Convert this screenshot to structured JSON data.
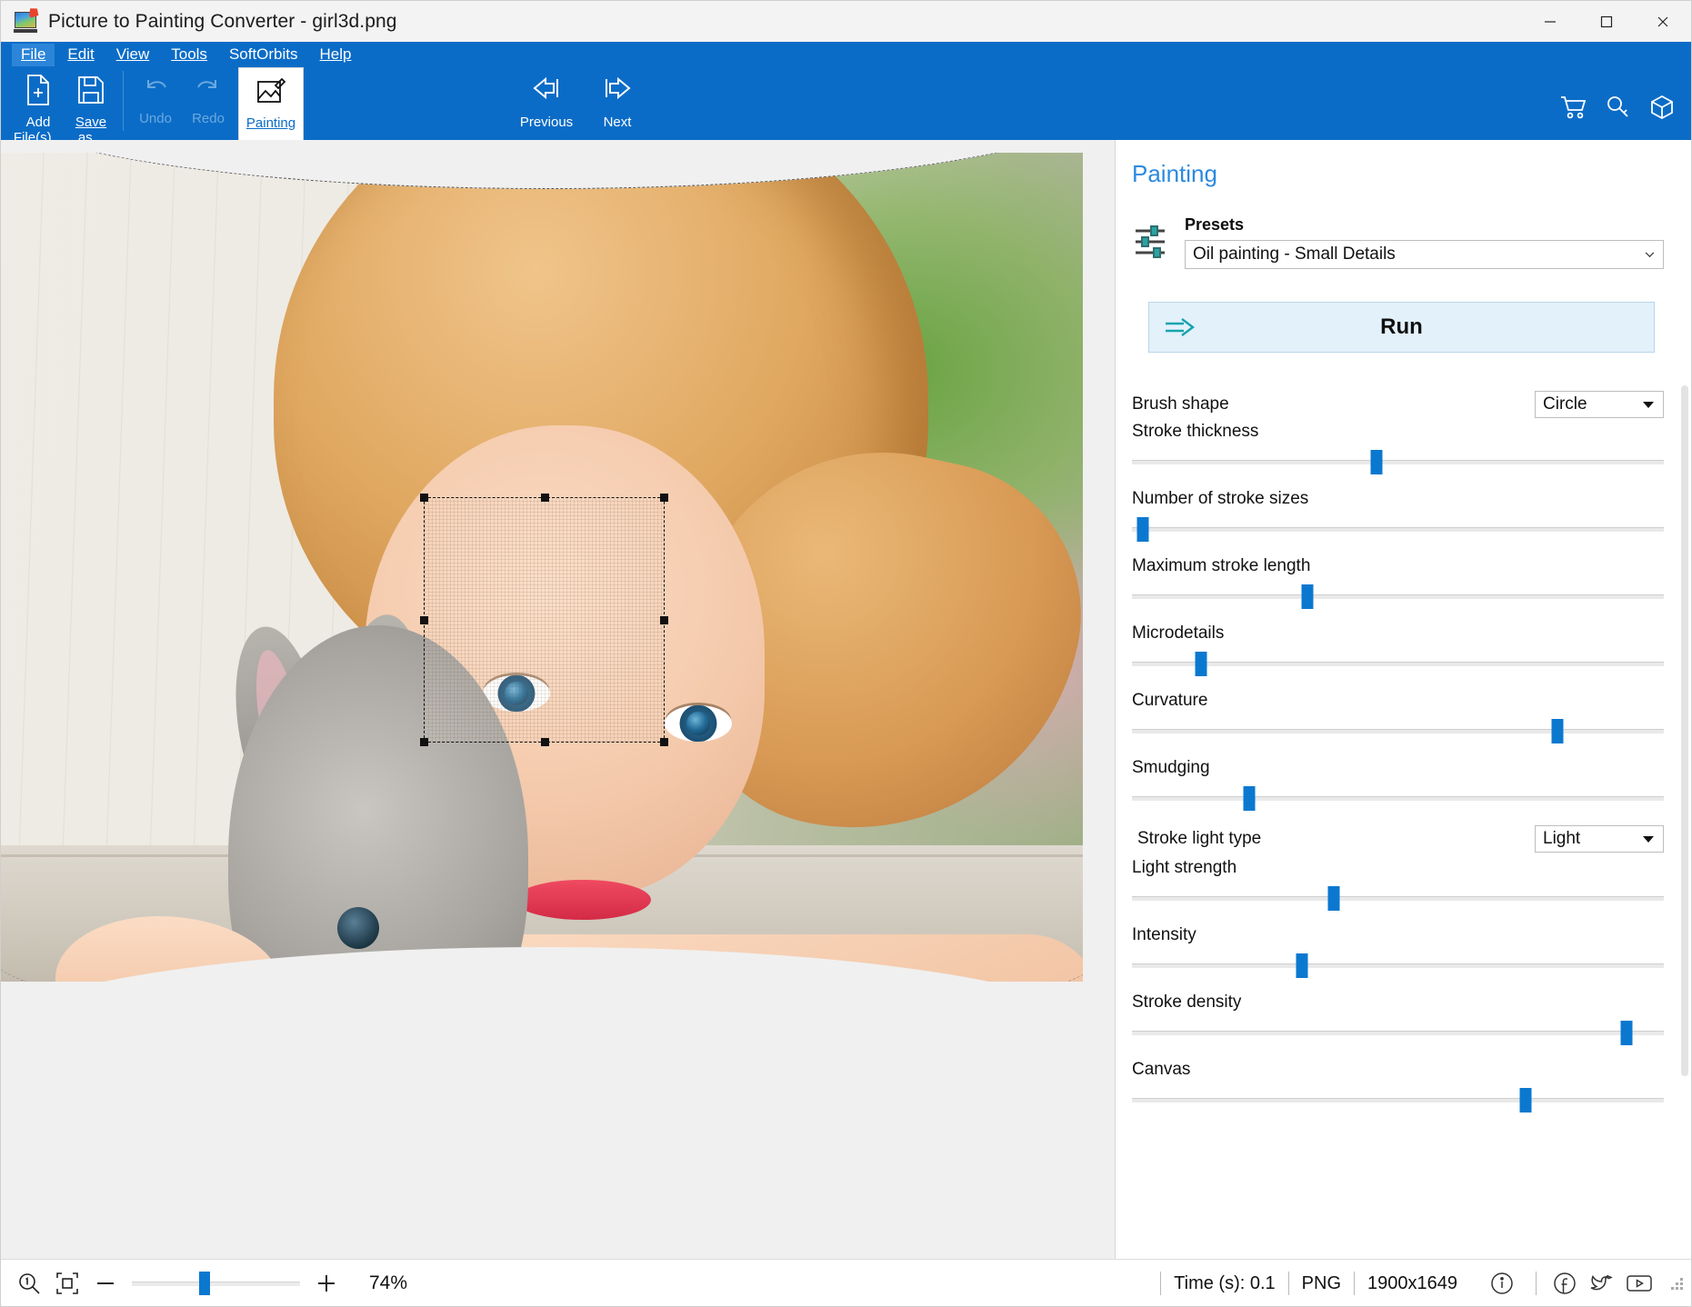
{
  "window": {
    "title": "Picture to Painting Converter - girl3d.png",
    "app_icon": "picture-to-painting-icon",
    "minimize_label": "Minimize",
    "maximize_label": "Maximize",
    "close_label": "Close"
  },
  "menubar": {
    "items": [
      {
        "label": "File",
        "accel": "F",
        "active": true
      },
      {
        "label": "Edit",
        "accel": "E",
        "active": false
      },
      {
        "label": "View",
        "accel": "V",
        "active": false
      },
      {
        "label": "Tools",
        "accel": "T",
        "active": false
      },
      {
        "label": "SoftOrbits",
        "accel": "",
        "active": false
      },
      {
        "label": "Help",
        "accel": "H",
        "active": false
      }
    ]
  },
  "ribbon": {
    "add_files_line1": "Add",
    "add_files_line2": "File(s)...",
    "save_as_line1": "Save",
    "save_as_line2": "as...",
    "undo_label": "Undo",
    "redo_label": "Redo",
    "painting_label": "Painting",
    "previous_label": "Previous",
    "next_label": "Next",
    "right_icons": [
      "cart-icon",
      "key-icon",
      "box-icon"
    ]
  },
  "panel": {
    "title": "Painting",
    "presets_label": "Presets",
    "presets_icon": "sliders-icon",
    "preset_value": "Oil painting - Small Details",
    "run_label": "Run",
    "run_icon": "run-arrow-icon",
    "controls": [
      {
        "type": "select",
        "label": "Brush shape",
        "value": "Circle"
      },
      {
        "type": "slider",
        "label": "Stroke thickness",
        "value": 46
      },
      {
        "type": "slider",
        "label": "Number of stroke sizes",
        "value": 2
      },
      {
        "type": "slider",
        "label": "Maximum stroke length",
        "value": 33
      },
      {
        "type": "slider",
        "label": "Microdetails",
        "value": 13
      },
      {
        "type": "slider",
        "label": "Curvature",
        "value": 80
      },
      {
        "type": "slider",
        "label": "Smudging",
        "value": 22
      },
      {
        "type": "select",
        "label": "Stroke light type",
        "value": "Light"
      },
      {
        "type": "slider",
        "label": "Light strength",
        "value": 38
      },
      {
        "type": "slider",
        "label": "Intensity",
        "value": 32
      },
      {
        "type": "slider",
        "label": "Stroke density",
        "value": 93
      },
      {
        "type": "slider",
        "label": "Canvas",
        "value": 74
      }
    ]
  },
  "statusbar": {
    "zoom_tool_icon": "zoom-one-to-one-icon",
    "fit_icon": "fit-to-window-icon",
    "zoom_out_label": "−",
    "zoom_in_label": "+",
    "zoom_value": 43,
    "zoom_percent": "74%",
    "time_label": "Time (s): 0.1",
    "format_label": "PNG",
    "dimensions_label": "1900x1649",
    "social_icons": [
      "info-icon",
      "facebook-icon",
      "twitter-icon",
      "youtube-icon"
    ]
  },
  "colors": {
    "ribbon_blue": "#0b6cc7",
    "accent_blue": "#0b78d0",
    "panel_title_blue": "#2b8ae0",
    "run_bg": "#e3f1fb"
  }
}
